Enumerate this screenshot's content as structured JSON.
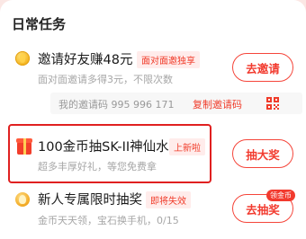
{
  "section": {
    "title": "日常任务"
  },
  "tasks": [
    {
      "title": "邀请好友赚48元",
      "tag": "面对面邀独享",
      "subtitle": "面对面邀请多得3元，不限次数",
      "button": "去邀请",
      "icon": "coin-icon"
    },
    {
      "title": "100金币抽SK-II神仙水",
      "tag": "上新啦",
      "subtitle": "超多丰厚好礼，等您免费拿",
      "button": "抽大奖",
      "icon": "gift-icon"
    },
    {
      "title": "新人专属限时抽奖",
      "tag": "即将失效",
      "subtitle": "金币天天领，宝石换手机，0/15",
      "button": "去抽奖",
      "button_badge": "领金币",
      "icon": "medal-icon"
    }
  ],
  "invite": {
    "code_label": "我的邀请码 995 996 171",
    "copy_label": "复制邀请码"
  },
  "colors": {
    "accent": "#f23a2e",
    "tag_bg": "#ffeceb",
    "highlight_border": "#e02020"
  }
}
